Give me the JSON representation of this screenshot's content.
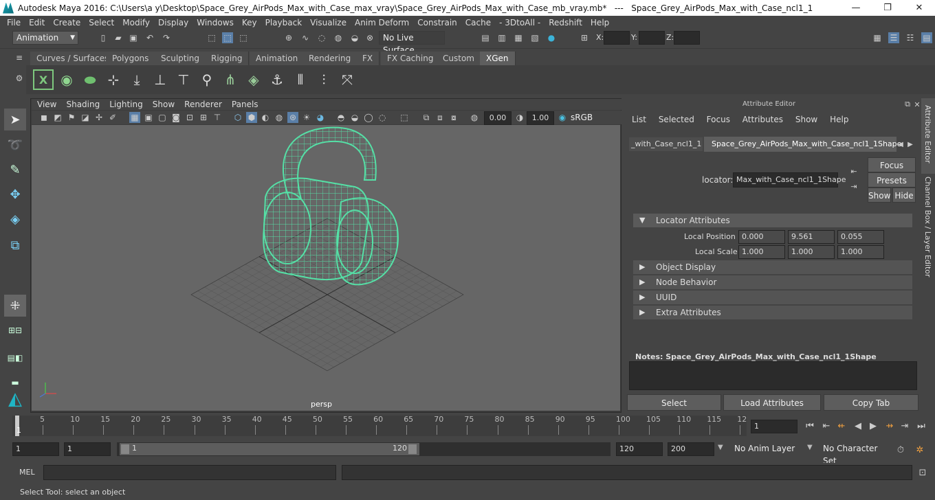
{
  "window": {
    "title": "Autodesk Maya 2016: C:\\Users\\a y\\Desktop\\Space_Grey_AirPods_Max_with_Case_max_vray\\Space_Grey_AirPods_Max_with_Case_mb_vray.mb*   ---   Space_Grey_AirPods_Max_with_Case_ncl1_1",
    "minimize": "—",
    "maximize": "❐",
    "close": "✕"
  },
  "menubar": [
    "File",
    "Edit",
    "Create",
    "Select",
    "Modify",
    "Display",
    "Windows",
    "Key",
    "Playback",
    "Visualize",
    "Anim Deform",
    "Constrain",
    "Cache",
    "- 3DtoAll -",
    "Redshift",
    "Help"
  ],
  "statusline": {
    "mode": "Animation",
    "live_surface": "No Live Surface",
    "x_label": "X:",
    "y_label": "Y:",
    "z_label": "Z:"
  },
  "shelf": {
    "tabs": [
      "Curves / Surfaces",
      "Polygons",
      "Sculpting",
      "Rigging",
      "Animation",
      "Rendering",
      "FX",
      "FX Caching",
      "Custom",
      "XGen"
    ],
    "active_tab": "XGen"
  },
  "viewport": {
    "menu": [
      "View",
      "Shading",
      "Lighting",
      "Show",
      "Renderer",
      "Panels"
    ],
    "near_value": "0.00",
    "far_value": "1.00",
    "color_space": "sRGB gamma",
    "camera_label": "persp",
    "wire_color": "#55e0a6"
  },
  "attribute_editor": {
    "title": "Attribute Editor",
    "menu": [
      "List",
      "Selected",
      "Focus",
      "Attributes",
      "Show",
      "Help"
    ],
    "tabs": [
      "_with_Case_ncl1_1",
      "Space_Grey_AirPods_Max_with_Case_ncl1_1Shape"
    ],
    "locator_label": "locator:",
    "locator_value": "Max_with_Case_ncl1_1Shape",
    "buttons": {
      "focus": "Focus",
      "presets": "Presets",
      "show": "Show",
      "hide": "Hide"
    },
    "sections": {
      "locator_attributes": "Locator Attributes",
      "object_display": "Object Display",
      "node_behavior": "Node Behavior",
      "uuid": "UUID",
      "extra_attributes": "Extra Attributes"
    },
    "local_position": {
      "label": "Local Position",
      "x": "0.000",
      "y": "9.561",
      "z": "0.055"
    },
    "local_scale": {
      "label": "Local Scale",
      "x": "1.000",
      "y": "1.000",
      "z": "1.000"
    },
    "notes_label": "Notes:  Space_Grey_AirPods_Max_with_Case_ncl1_1Shape",
    "bottom_buttons": {
      "select": "Select",
      "load": "Load Attributes",
      "copy": "Copy Tab"
    }
  },
  "side_tabs": {
    "attribute_editor": "Attribute Editor",
    "channel_box": "Channel Box / Layer Editor"
  },
  "timeline": {
    "ticks": [
      "5",
      "10",
      "15",
      "20",
      "25",
      "30",
      "35",
      "40",
      "45",
      "50",
      "55",
      "60",
      "65",
      "70",
      "75",
      "80",
      "85",
      "90",
      "95",
      "100",
      "105",
      "110",
      "115",
      "12"
    ],
    "current_frame_marker": "1",
    "current_frame": "1"
  },
  "range": {
    "start": "1",
    "playback_start": "1",
    "slider_start": "1",
    "slider_end": "120",
    "playback_end": "120",
    "end": "200",
    "anim_layer": "No Anim Layer",
    "character_set": "No Character Set"
  },
  "cmdline": {
    "label": "MEL"
  },
  "helpline": {
    "text": "Select Tool: select an object"
  }
}
